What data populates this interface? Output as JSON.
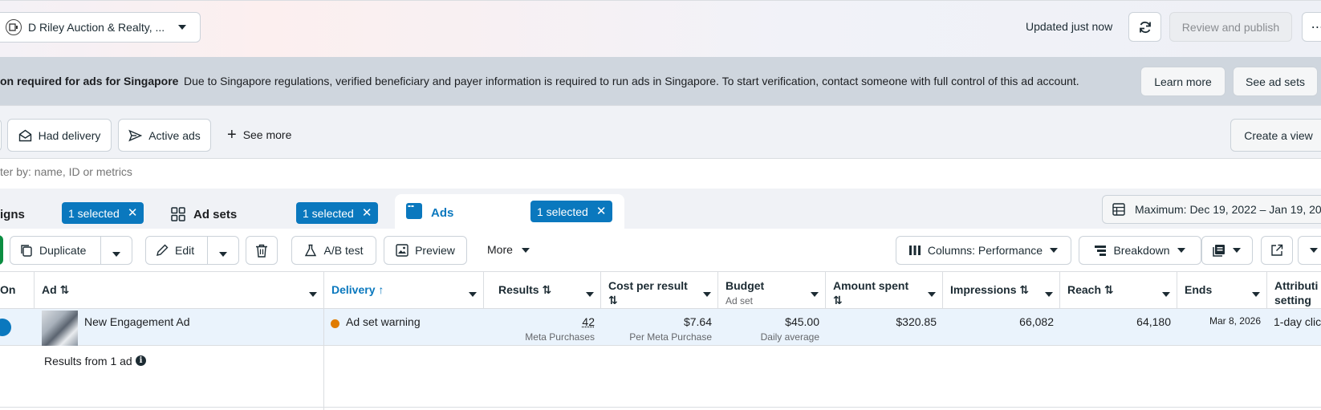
{
  "account": {
    "name": "D Riley Auction & Realty, ..."
  },
  "topbar": {
    "status": "Updated just now",
    "review_label": "Review and publish"
  },
  "banner": {
    "title": "on required for ads for Singapore",
    "message": "Due to Singapore regulations, verified beneficiary and payer information is required to run ads in Singapore. To start verification, contact someone with full control of this ad account.",
    "learn_more": "Learn more",
    "see_ad_sets": "See ad sets"
  },
  "filters": {
    "had_delivery": "Had delivery",
    "active_ads": "Active ads",
    "see_more": "See more",
    "create_view": "Create a view"
  },
  "search": {
    "placeholder": "ter by: name, ID or metrics"
  },
  "tabs": {
    "campaigns": {
      "label": "igns",
      "chip": "1 selected"
    },
    "adsets": {
      "label": "Ad sets",
      "chip": "1 selected"
    },
    "ads": {
      "label": "Ads",
      "chip": "1 selected"
    }
  },
  "date_range": "Maximum: Dec 19, 2022 – Jan 19, 202",
  "toolbar": {
    "duplicate": "Duplicate",
    "edit": "Edit",
    "ab_test": "A/B test",
    "preview": "Preview",
    "more": "More",
    "columns": "Columns: Performance",
    "breakdown": "Breakdown"
  },
  "table": {
    "headers": {
      "on": "On",
      "ad": "Ad",
      "delivery": "Delivery",
      "results": "Results",
      "cost_per_result": "Cost per result",
      "budget": "Budget",
      "budget_sub": "Ad set",
      "amount_spent": "Amount spent",
      "impressions": "Impressions",
      "reach": "Reach",
      "ends": "Ends",
      "attribution_1": "Attributi",
      "attribution_2": "setting"
    },
    "row": {
      "ad_name": "New Engagement Ad",
      "delivery": "Ad set warning",
      "results": "42",
      "results_sub": "Meta Purchases",
      "cost_per_result": "$7.64",
      "cost_sub": "Per Meta Purchase",
      "budget": "$45.00",
      "budget_sub": "Daily average",
      "amount_spent": "$320.85",
      "impressions": "66,082",
      "reach": "64,180",
      "ends": "Mar 8, 2026",
      "attribution": "1-day clic"
    },
    "summary": "Results from 1 ad"
  },
  "colors": {
    "accent": "#0a78be",
    "banner_bg": "#cfd6de",
    "warning_dot": "#e07b00",
    "row_bg": "#eaf3fc"
  }
}
